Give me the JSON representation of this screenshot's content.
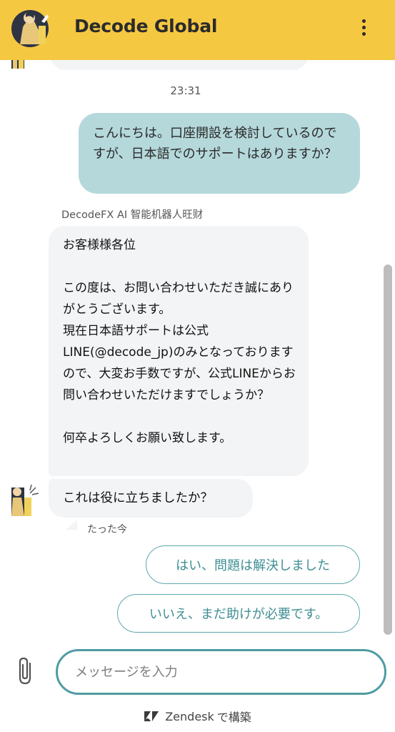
{
  "header": {
    "title": "Decode Global",
    "bg_color": "#f5c842"
  },
  "chat": {
    "timestamp": "23:31",
    "user_message": "こんにちは。口座開設を検討しているのですが、日本語でのサポートはありますか？",
    "bot_name": "DecodeFX AI 智能机器人旺财",
    "bot_message": "お客様様各位\n\nこの度は、お問い合わせいただき誠にありがとうございます。\n現在日本語サポートは公式LINE(@decode_jp)のみとなっておりますので、大変お手数ですが、公式LINEからお問い合わせいただけますでしょうか？\n\n何卒よろしくお願い致します。",
    "bot_question": "これは役に立ちましたか？",
    "sent_time": "たった今",
    "quick_replies": [
      {
        "label": "はい、問題は解決しました"
      },
      {
        "label": "いいえ、まだ助けが必要です。"
      }
    ]
  },
  "composer": {
    "placeholder": "メッセージを入力",
    "footer_brand": "Zendesk",
    "footer_suffix": "で構築"
  },
  "colors": {
    "user_bubble": "#b5d8db",
    "bot_bubble": "#f3f4f6",
    "accent": "#4e9ca2"
  },
  "icons": [
    "brand-logo-icon",
    "more-vert-icon",
    "paperclip-icon",
    "zendesk-icon",
    "bot-avatar-icon"
  ]
}
